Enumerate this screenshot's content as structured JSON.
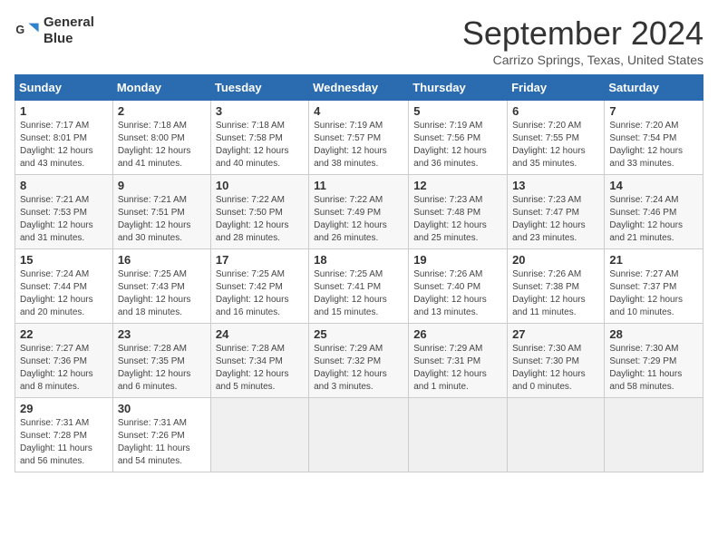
{
  "header": {
    "logo_line1": "General",
    "logo_line2": "Blue",
    "month_title": "September 2024",
    "subtitle": "Carrizo Springs, Texas, United States"
  },
  "weekdays": [
    "Sunday",
    "Monday",
    "Tuesday",
    "Wednesday",
    "Thursday",
    "Friday",
    "Saturday"
  ],
  "weeks": [
    [
      {
        "day": "1",
        "sunrise": "7:17 AM",
        "sunset": "8:01 PM",
        "daylight": "12 hours and 43 minutes."
      },
      {
        "day": "2",
        "sunrise": "7:18 AM",
        "sunset": "8:00 PM",
        "daylight": "12 hours and 41 minutes."
      },
      {
        "day": "3",
        "sunrise": "7:18 AM",
        "sunset": "7:58 PM",
        "daylight": "12 hours and 40 minutes."
      },
      {
        "day": "4",
        "sunrise": "7:19 AM",
        "sunset": "7:57 PM",
        "daylight": "12 hours and 38 minutes."
      },
      {
        "day": "5",
        "sunrise": "7:19 AM",
        "sunset": "7:56 PM",
        "daylight": "12 hours and 36 minutes."
      },
      {
        "day": "6",
        "sunrise": "7:20 AM",
        "sunset": "7:55 PM",
        "daylight": "12 hours and 35 minutes."
      },
      {
        "day": "7",
        "sunrise": "7:20 AM",
        "sunset": "7:54 PM",
        "daylight": "12 hours and 33 minutes."
      }
    ],
    [
      {
        "day": "8",
        "sunrise": "7:21 AM",
        "sunset": "7:53 PM",
        "daylight": "12 hours and 31 minutes."
      },
      {
        "day": "9",
        "sunrise": "7:21 AM",
        "sunset": "7:51 PM",
        "daylight": "12 hours and 30 minutes."
      },
      {
        "day": "10",
        "sunrise": "7:22 AM",
        "sunset": "7:50 PM",
        "daylight": "12 hours and 28 minutes."
      },
      {
        "day": "11",
        "sunrise": "7:22 AM",
        "sunset": "7:49 PM",
        "daylight": "12 hours and 26 minutes."
      },
      {
        "day": "12",
        "sunrise": "7:23 AM",
        "sunset": "7:48 PM",
        "daylight": "12 hours and 25 minutes."
      },
      {
        "day": "13",
        "sunrise": "7:23 AM",
        "sunset": "7:47 PM",
        "daylight": "12 hours and 23 minutes."
      },
      {
        "day": "14",
        "sunrise": "7:24 AM",
        "sunset": "7:46 PM",
        "daylight": "12 hours and 21 minutes."
      }
    ],
    [
      {
        "day": "15",
        "sunrise": "7:24 AM",
        "sunset": "7:44 PM",
        "daylight": "12 hours and 20 minutes."
      },
      {
        "day": "16",
        "sunrise": "7:25 AM",
        "sunset": "7:43 PM",
        "daylight": "12 hours and 18 minutes."
      },
      {
        "day": "17",
        "sunrise": "7:25 AM",
        "sunset": "7:42 PM",
        "daylight": "12 hours and 16 minutes."
      },
      {
        "day": "18",
        "sunrise": "7:25 AM",
        "sunset": "7:41 PM",
        "daylight": "12 hours and 15 minutes."
      },
      {
        "day": "19",
        "sunrise": "7:26 AM",
        "sunset": "7:40 PM",
        "daylight": "12 hours and 13 minutes."
      },
      {
        "day": "20",
        "sunrise": "7:26 AM",
        "sunset": "7:38 PM",
        "daylight": "12 hours and 11 minutes."
      },
      {
        "day": "21",
        "sunrise": "7:27 AM",
        "sunset": "7:37 PM",
        "daylight": "12 hours and 10 minutes."
      }
    ],
    [
      {
        "day": "22",
        "sunrise": "7:27 AM",
        "sunset": "7:36 PM",
        "daylight": "12 hours and 8 minutes."
      },
      {
        "day": "23",
        "sunrise": "7:28 AM",
        "sunset": "7:35 PM",
        "daylight": "12 hours and 6 minutes."
      },
      {
        "day": "24",
        "sunrise": "7:28 AM",
        "sunset": "7:34 PM",
        "daylight": "12 hours and 5 minutes."
      },
      {
        "day": "25",
        "sunrise": "7:29 AM",
        "sunset": "7:32 PM",
        "daylight": "12 hours and 3 minutes."
      },
      {
        "day": "26",
        "sunrise": "7:29 AM",
        "sunset": "7:31 PM",
        "daylight": "12 hours and 1 minute."
      },
      {
        "day": "27",
        "sunrise": "7:30 AM",
        "sunset": "7:30 PM",
        "daylight": "12 hours and 0 minutes."
      },
      {
        "day": "28",
        "sunrise": "7:30 AM",
        "sunset": "7:29 PM",
        "daylight": "11 hours and 58 minutes."
      }
    ],
    [
      {
        "day": "29",
        "sunrise": "7:31 AM",
        "sunset": "7:28 PM",
        "daylight": "11 hours and 56 minutes."
      },
      {
        "day": "30",
        "sunrise": "7:31 AM",
        "sunset": "7:26 PM",
        "daylight": "11 hours and 54 minutes."
      },
      null,
      null,
      null,
      null,
      null
    ]
  ]
}
